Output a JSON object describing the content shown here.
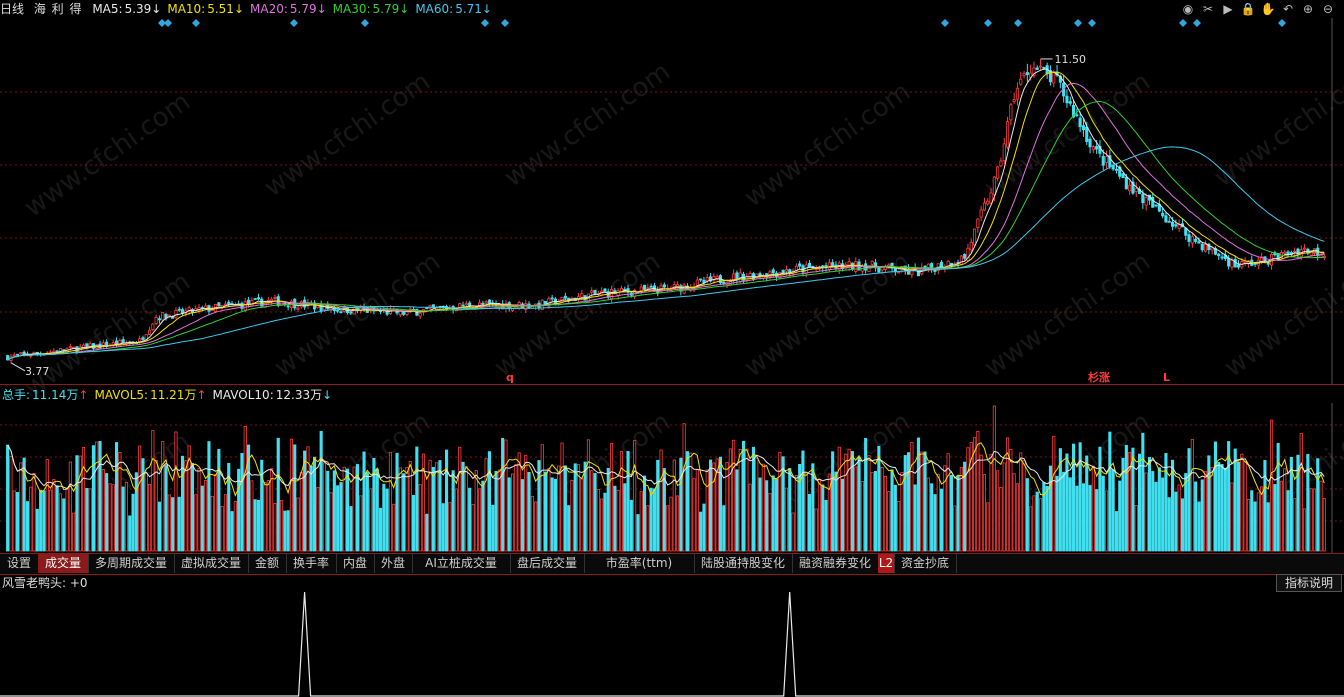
{
  "header": {
    "period": "日线",
    "stock_name": "海 利 得",
    "ma": [
      {
        "label": "MA5:",
        "value": "5.39",
        "arrow": "↓",
        "color": "#e8e8e8"
      },
      {
        "label": "MA10:",
        "value": "5.51",
        "arrow": "↓",
        "color": "#f0e000"
      },
      {
        "label": "MA20:",
        "value": "5.79",
        "arrow": "↓",
        "color": "#e070e0"
      },
      {
        "label": "MA30:",
        "value": "5.79",
        "arrow": "↓",
        "color": "#30d030"
      },
      {
        "label": "MA60:",
        "value": "5.71",
        "arrow": "↓",
        "color": "#40c8f0"
      }
    ],
    "controls": [
      "eye-icon",
      "tools-icon",
      "play-icon",
      "lock-icon",
      "hand-icon",
      "undo-icon",
      "zoom-in-icon",
      "zoom-out-icon"
    ],
    "controls_glyphs": [
      "◉",
      "✂",
      "▶",
      "🔒",
      "✋",
      "↶",
      "⊕",
      "⊖"
    ]
  },
  "price_panel": {
    "high_label": "11.50",
    "low_label": "3.77",
    "markers": [
      {
        "text": "q"
      },
      {
        "text": "杉涨"
      },
      {
        "text": "L"
      }
    ]
  },
  "volume_panel": {
    "items": [
      {
        "label": "总手:",
        "value": "11.14万",
        "arrow": "↑",
        "color": "#40e0f0"
      },
      {
        "label": "MAVOL5:",
        "value": "11.21万",
        "arrow": "↑",
        "color": "#f0e000"
      },
      {
        "label": "MAVOL10:",
        "value": "12.33万",
        "arrow": "↓",
        "color": "#e8e8e8"
      }
    ]
  },
  "tabs": [
    "设置",
    "成交量",
    "多周期成交量",
    "虚拟成交量",
    "金额",
    "换手率",
    "内盘",
    "外盘",
    "AI立桩成交量",
    "盘后成交量",
    "市盈率(ttm)",
    "陆股通持股变化",
    "融资融券变化",
    "L2",
    "资金抄底"
  ],
  "active_tab": 1,
  "indicator_panel": {
    "title": "风雪老鸭头:",
    "value": "+0",
    "button": "指标说明"
  },
  "watermark": "www.cfchi.com",
  "colors": {
    "up": "#ff3b3b",
    "down": "#40e0f0",
    "grid": "#7a1515",
    "bg": "#000000"
  },
  "chart_data": [
    {
      "type": "candlestick",
      "title": "海 利 得 日线",
      "price_range": [
        3.77,
        11.5
      ],
      "ma_series": [
        "MA5",
        "MA10",
        "MA20",
        "MA30",
        "MA60"
      ],
      "trend_points": [
        {
          "x": 0,
          "close": 3.9
        },
        {
          "x": 20,
          "close": 4.1
        },
        {
          "x": 40,
          "close": 4.3
        },
        {
          "x": 45,
          "close": 4.9
        },
        {
          "x": 60,
          "close": 5.1
        },
        {
          "x": 80,
          "close": 5.3
        },
        {
          "x": 100,
          "close": 5.1
        },
        {
          "x": 120,
          "close": 5.0
        },
        {
          "x": 140,
          "close": 5.2
        },
        {
          "x": 160,
          "close": 5.2
        },
        {
          "x": 180,
          "close": 5.5
        },
        {
          "x": 200,
          "close": 5.6
        },
        {
          "x": 220,
          "close": 5.9
        },
        {
          "x": 240,
          "close": 6.1
        },
        {
          "x": 260,
          "close": 6.2
        },
        {
          "x": 275,
          "close": 6.0
        },
        {
          "x": 290,
          "close": 6.4
        },
        {
          "x": 300,
          "close": 8.5
        },
        {
          "x": 305,
          "close": 10.5
        },
        {
          "x": 310,
          "close": 11.2
        },
        {
          "x": 318,
          "close": 10.8
        },
        {
          "x": 330,
          "close": 9.0
        },
        {
          "x": 345,
          "close": 7.8
        },
        {
          "x": 360,
          "close": 6.8
        },
        {
          "x": 372,
          "close": 6.2
        },
        {
          "x": 380,
          "close": 6.3
        },
        {
          "x": 392,
          "close": 6.6
        },
        {
          "x": 400,
          "close": 6.5
        }
      ]
    },
    {
      "type": "bar",
      "title": "成交量",
      "series": [
        "总手",
        "MAVOL5",
        "MAVOL10"
      ],
      "values_unit": "万"
    },
    {
      "type": "line",
      "title": "风雪老鸭头",
      "spikes_at_x": [
        90,
        237
      ]
    }
  ]
}
